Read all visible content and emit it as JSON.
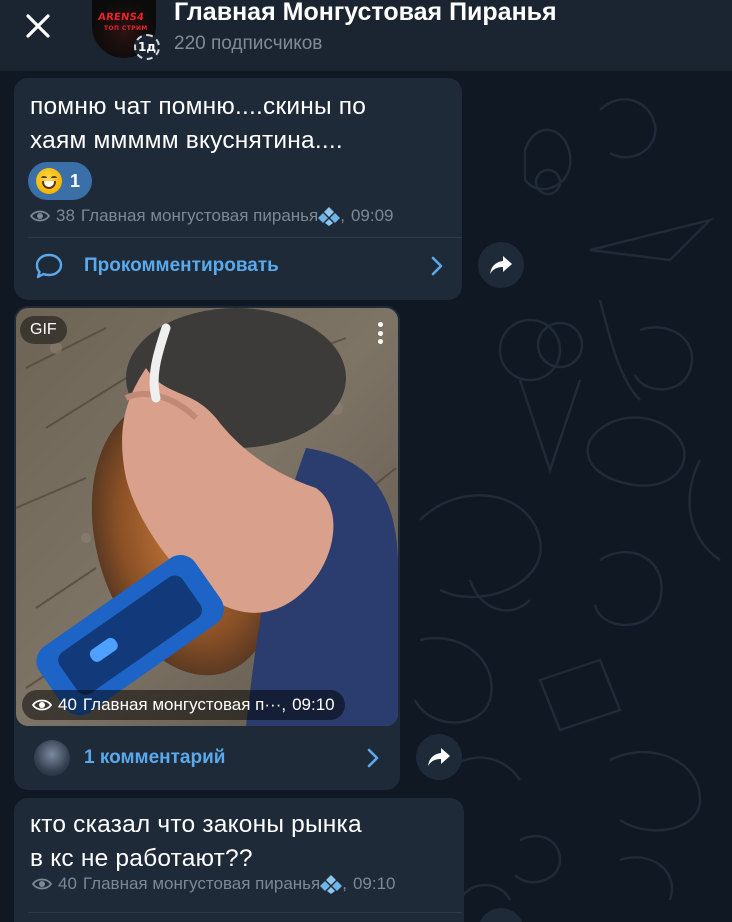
{
  "header": {
    "close_icon": "close-icon",
    "avatar_text_main": "ARENS4",
    "avatar_text_sub": "ТОП СТРИМ",
    "story_badge": "1д",
    "title": "Главная Монгустовая Пиранья",
    "subtitle": "220 подписчиков"
  },
  "messages": [
    {
      "text_line1": "помню чат помню....скины по",
      "text_line2": "хаям ммммм вкуснятина....",
      "reaction": {
        "emoji": "grinning-face",
        "count": "1"
      },
      "views": "38",
      "author": "Главная монгустовая пиранья",
      "time": "09:09",
      "comment_label": "Прокомментировать"
    },
    {
      "media_badge": "GIF",
      "views": "40",
      "author": "Главная монгустовая п···",
      "time": "09:10",
      "comment_label": "1 комментарий"
    },
    {
      "text_line1": "кто сказал что законы рынка",
      "text_line2": "в кс не работают??",
      "views": "40",
      "author": "Главная монгустовая пиранья",
      "time": "09:10"
    }
  ],
  "colors": {
    "background": "#0f1823",
    "header": "#1b2531",
    "bubble": "#1e2a38",
    "accent": "#5aa9ec",
    "reaction": "#3a6fa8",
    "meta_text": "#7d8894"
  }
}
